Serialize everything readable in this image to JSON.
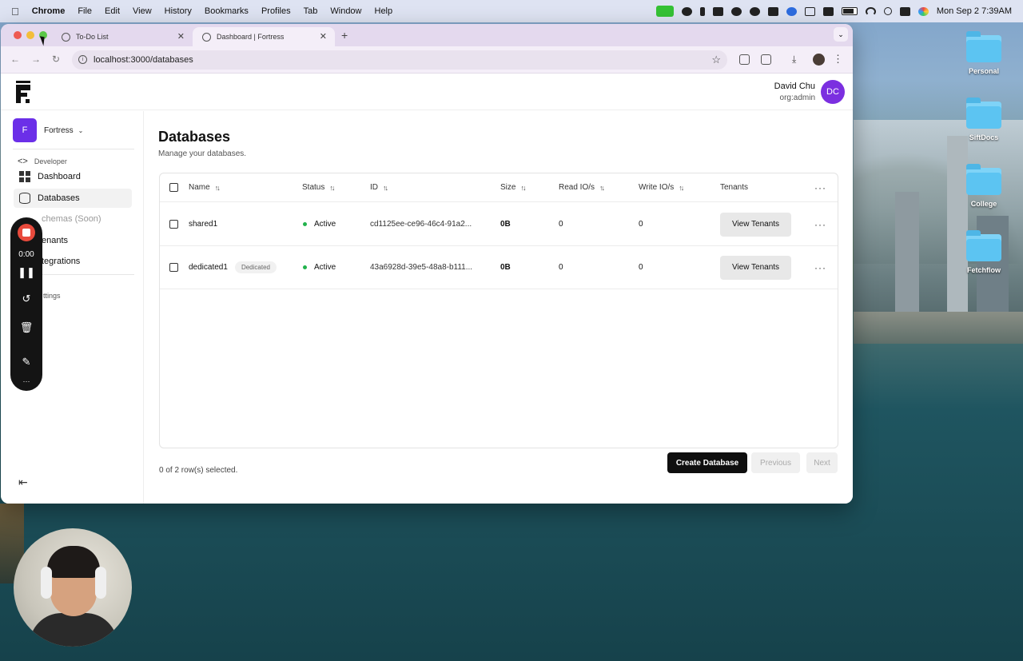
{
  "menubar": {
    "app": "Chrome",
    "items": [
      "File",
      "Edit",
      "View",
      "History",
      "Bookmarks",
      "Profiles",
      "Tab",
      "Window",
      "Help"
    ],
    "clock": "Mon Sep 2  7:39AM"
  },
  "desktop": {
    "icons": [
      "Personal",
      "SiftDocs",
      "College",
      "Fetchflow"
    ]
  },
  "browser": {
    "tabs": [
      {
        "title": "To-Do List"
      },
      {
        "title": "Dashboard | Fortress"
      }
    ],
    "url": "localhost:3000/databases"
  },
  "header": {
    "user_name": "David Chu",
    "user_role": "org:admin",
    "avatar_initials": "DC"
  },
  "sidebar": {
    "org_badge": "F",
    "org_name": "Fortress",
    "section": "Developer",
    "items": [
      {
        "label": "Dashboard"
      },
      {
        "label": "Databases"
      },
      {
        "label": "chemas (Soon)"
      },
      {
        "label": "enants"
      },
      {
        "label": "tegrations"
      }
    ],
    "settings": "ttings"
  },
  "main": {
    "title": "Databases",
    "subtitle": "Manage your databases.",
    "columns": [
      "Name",
      "Status",
      "ID",
      "Size",
      "Read IO/s",
      "Write IO/s",
      "Tenants"
    ],
    "rows": [
      {
        "name": "shared1",
        "tag": "",
        "status": "Active",
        "id": "cd1125ee-ce96-46c4-91a2...",
        "size": "0B",
        "read": "0",
        "write": "0",
        "action": "View Tenants"
      },
      {
        "name": "dedicated1",
        "tag": "Dedicated",
        "status": "Active",
        "id": "43a6928d-39e5-48a8-b111...",
        "size": "0B",
        "read": "0",
        "write": "0",
        "action": "View Tenants"
      }
    ],
    "selection_text": "0 of 2 row(s) selected.",
    "create_label": "Create Database",
    "prev_label": "Previous",
    "next_label": "Next"
  },
  "recorder": {
    "time": "0:00"
  },
  "colors": {
    "accent_purple": "#6b2fe8",
    "avatar_purple": "#7b2fe0",
    "status_green": "#22b24c",
    "record_red": "#e84a3c"
  }
}
